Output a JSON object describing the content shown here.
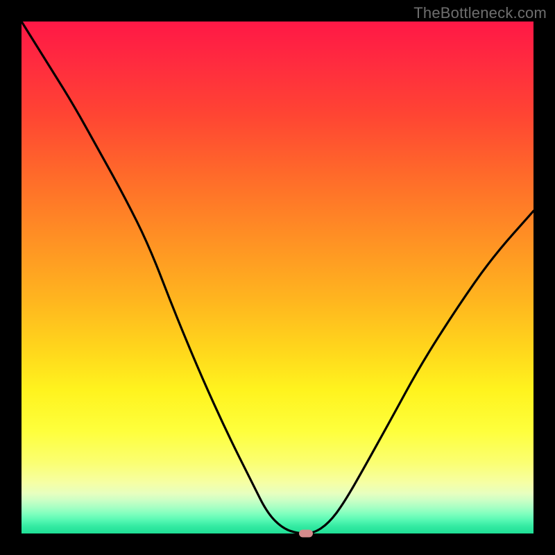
{
  "watermark": "TheBottleneck.com",
  "colors": {
    "frame": "#000000",
    "curve": "#000000",
    "marker": "#d58b8c"
  },
  "chart_data": {
    "type": "line",
    "title": "",
    "xlabel": "",
    "ylabel": "",
    "xlim": [
      0,
      100
    ],
    "ylim": [
      0,
      100
    ],
    "grid": false,
    "legend": false,
    "series": [
      {
        "name": "bottleneck-curve",
        "x": [
          0,
          5,
          10,
          15,
          20,
          25,
          30,
          35,
          40,
          45,
          48,
          51,
          54,
          57,
          60,
          63,
          67,
          72,
          78,
          85,
          92,
          100
        ],
        "y": [
          100,
          92,
          84,
          75,
          66,
          56,
          43,
          31,
          20,
          10,
          4,
          1,
          0,
          0,
          2,
          6,
          13,
          22,
          33,
          44,
          54,
          63
        ]
      }
    ],
    "marker": {
      "x": 55.5,
      "y": 0,
      "color": "#d58b8c"
    },
    "background_gradient": {
      "type": "linear-vertical",
      "stops": [
        {
          "pos": 0.0,
          "color": "#ff1846"
        },
        {
          "pos": 0.3,
          "color": "#ff6a2a"
        },
        {
          "pos": 0.64,
          "color": "#ffd61c"
        },
        {
          "pos": 0.86,
          "color": "#fbff70"
        },
        {
          "pos": 1.0,
          "color": "#1fe096"
        }
      ]
    }
  }
}
